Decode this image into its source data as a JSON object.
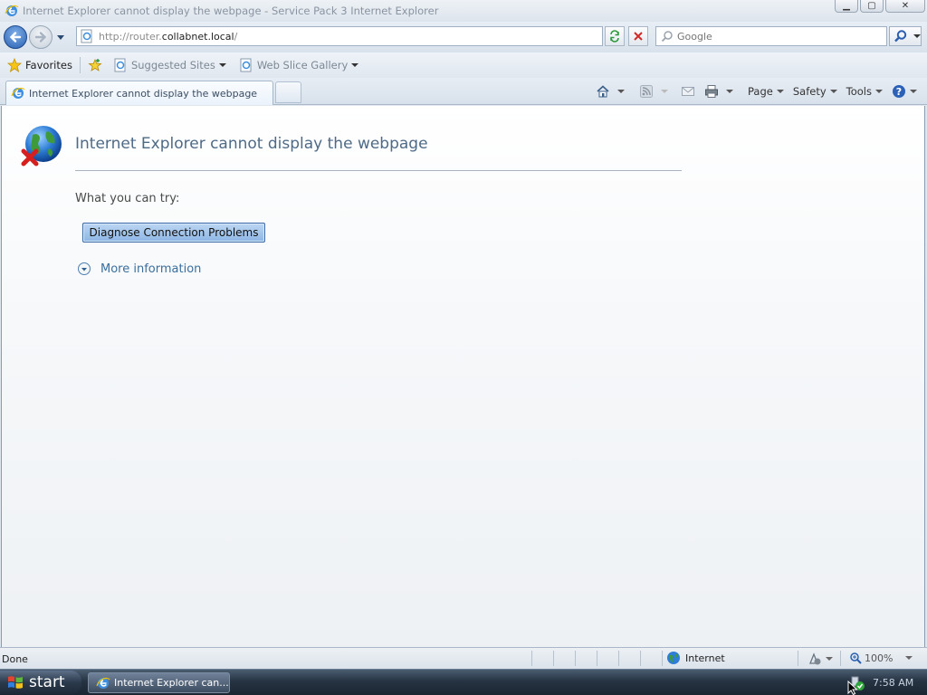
{
  "window": {
    "title": "Internet Explorer cannot display the webpage - Service Pack 3 Internet Explorer",
    "minimize": "▁",
    "maximize": "▢",
    "close": "✕"
  },
  "address": {
    "url_prefix": "http://router.",
    "url_host": "collabnet.local",
    "url_suffix": "/"
  },
  "search": {
    "placeholder": "Google"
  },
  "favorites_bar": {
    "favorites_label": "Favorites",
    "suggested_sites_label": "Suggested Sites",
    "web_slice_gallery_label": "Web Slice Gallery"
  },
  "tabs": [
    {
      "label": "Internet Explorer cannot display the webpage",
      "active": true
    }
  ],
  "command_bar": {
    "page_label": "Page",
    "safety_label": "Safety",
    "tools_label": "Tools"
  },
  "page": {
    "heading": "Internet Explorer cannot display the webpage",
    "try_label": "What you can try:",
    "diagnose_button": "Diagnose Connection Problems",
    "more_info_link": "More information"
  },
  "status_bar": {
    "status_text": "Done",
    "zone": "Internet",
    "zoom": "100%"
  },
  "taskbar": {
    "start_label": "start",
    "task_item": "Internet Explorer can...",
    "clock": "7:58 AM"
  },
  "colors": {
    "accent": "#2a5fb0",
    "heading_text": "#4e6a86",
    "link": "#3b6f9c",
    "button_fill": "#a6c8ee"
  },
  "icons": {
    "app": "ie-icon",
    "back": "back-arrow-icon",
    "forward": "forward-arrow-icon",
    "refresh": "refresh-icon",
    "stop": "stop-icon",
    "search": "magnifier-icon",
    "favorites": "star-icon",
    "home": "home-icon",
    "feeds": "rss-icon",
    "mail": "mail-icon",
    "print": "printer-icon",
    "help": "help-icon",
    "error": "globe-error-icon",
    "more_info": "expand-chevron-icon"
  }
}
